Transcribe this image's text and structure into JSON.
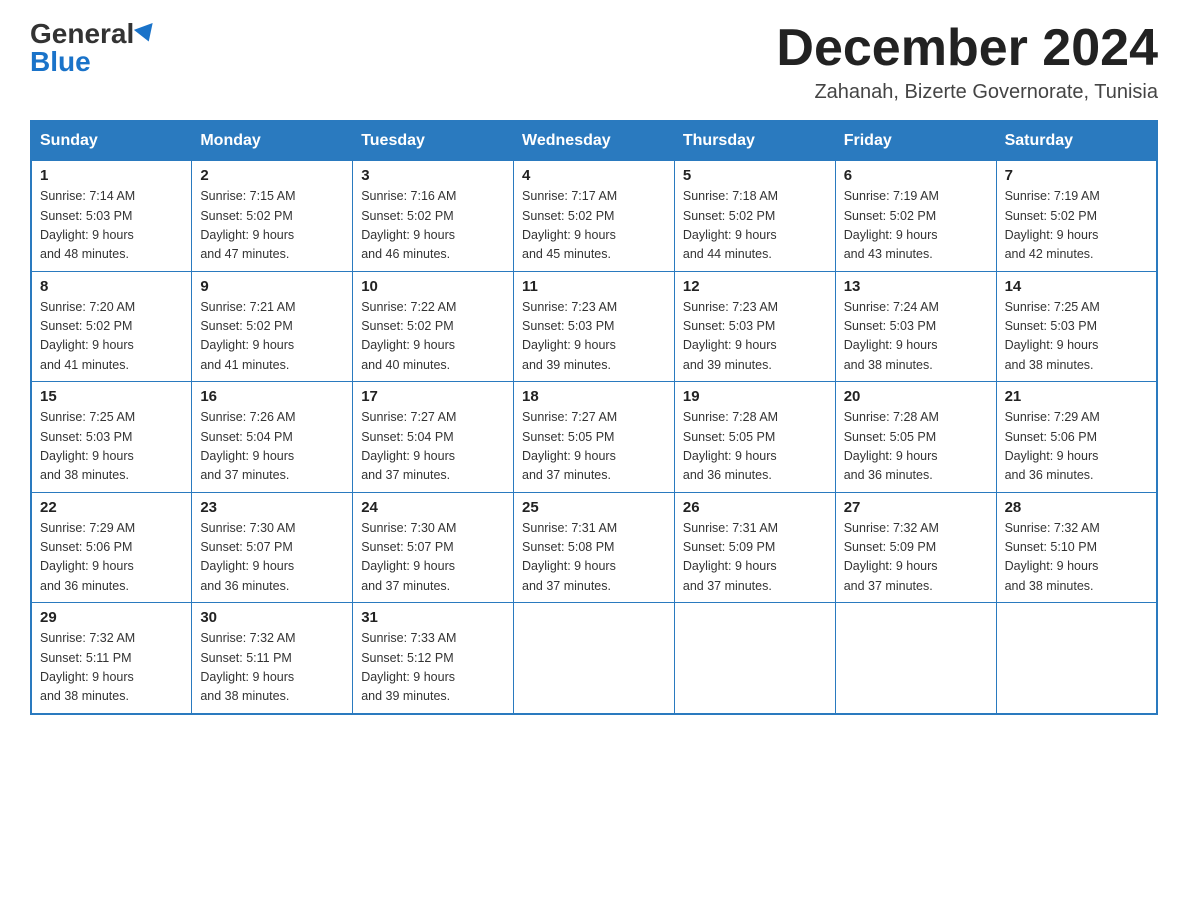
{
  "logo": {
    "general": "General",
    "blue": "Blue"
  },
  "title": "December 2024",
  "subtitle": "Zahanah, Bizerte Governorate, Tunisia",
  "days_of_week": [
    "Sunday",
    "Monday",
    "Tuesday",
    "Wednesday",
    "Thursday",
    "Friday",
    "Saturday"
  ],
  "weeks": [
    [
      {
        "day": "1",
        "sunrise": "7:14 AM",
        "sunset": "5:03 PM",
        "daylight": "9 hours and 48 minutes."
      },
      {
        "day": "2",
        "sunrise": "7:15 AM",
        "sunset": "5:02 PM",
        "daylight": "9 hours and 47 minutes."
      },
      {
        "day": "3",
        "sunrise": "7:16 AM",
        "sunset": "5:02 PM",
        "daylight": "9 hours and 46 minutes."
      },
      {
        "day": "4",
        "sunrise": "7:17 AM",
        "sunset": "5:02 PM",
        "daylight": "9 hours and 45 minutes."
      },
      {
        "day": "5",
        "sunrise": "7:18 AM",
        "sunset": "5:02 PM",
        "daylight": "9 hours and 44 minutes."
      },
      {
        "day": "6",
        "sunrise": "7:19 AM",
        "sunset": "5:02 PM",
        "daylight": "9 hours and 43 minutes."
      },
      {
        "day": "7",
        "sunrise": "7:19 AM",
        "sunset": "5:02 PM",
        "daylight": "9 hours and 42 minutes."
      }
    ],
    [
      {
        "day": "8",
        "sunrise": "7:20 AM",
        "sunset": "5:02 PM",
        "daylight": "9 hours and 41 minutes."
      },
      {
        "day": "9",
        "sunrise": "7:21 AM",
        "sunset": "5:02 PM",
        "daylight": "9 hours and 41 minutes."
      },
      {
        "day": "10",
        "sunrise": "7:22 AM",
        "sunset": "5:02 PM",
        "daylight": "9 hours and 40 minutes."
      },
      {
        "day": "11",
        "sunrise": "7:23 AM",
        "sunset": "5:03 PM",
        "daylight": "9 hours and 39 minutes."
      },
      {
        "day": "12",
        "sunrise": "7:23 AM",
        "sunset": "5:03 PM",
        "daylight": "9 hours and 39 minutes."
      },
      {
        "day": "13",
        "sunrise": "7:24 AM",
        "sunset": "5:03 PM",
        "daylight": "9 hours and 38 minutes."
      },
      {
        "day": "14",
        "sunrise": "7:25 AM",
        "sunset": "5:03 PM",
        "daylight": "9 hours and 38 minutes."
      }
    ],
    [
      {
        "day": "15",
        "sunrise": "7:25 AM",
        "sunset": "5:03 PM",
        "daylight": "9 hours and 38 minutes."
      },
      {
        "day": "16",
        "sunrise": "7:26 AM",
        "sunset": "5:04 PM",
        "daylight": "9 hours and 37 minutes."
      },
      {
        "day": "17",
        "sunrise": "7:27 AM",
        "sunset": "5:04 PM",
        "daylight": "9 hours and 37 minutes."
      },
      {
        "day": "18",
        "sunrise": "7:27 AM",
        "sunset": "5:05 PM",
        "daylight": "9 hours and 37 minutes."
      },
      {
        "day": "19",
        "sunrise": "7:28 AM",
        "sunset": "5:05 PM",
        "daylight": "9 hours and 36 minutes."
      },
      {
        "day": "20",
        "sunrise": "7:28 AM",
        "sunset": "5:05 PM",
        "daylight": "9 hours and 36 minutes."
      },
      {
        "day": "21",
        "sunrise": "7:29 AM",
        "sunset": "5:06 PM",
        "daylight": "9 hours and 36 minutes."
      }
    ],
    [
      {
        "day": "22",
        "sunrise": "7:29 AM",
        "sunset": "5:06 PM",
        "daylight": "9 hours and 36 minutes."
      },
      {
        "day": "23",
        "sunrise": "7:30 AM",
        "sunset": "5:07 PM",
        "daylight": "9 hours and 36 minutes."
      },
      {
        "day": "24",
        "sunrise": "7:30 AM",
        "sunset": "5:07 PM",
        "daylight": "9 hours and 37 minutes."
      },
      {
        "day": "25",
        "sunrise": "7:31 AM",
        "sunset": "5:08 PM",
        "daylight": "9 hours and 37 minutes."
      },
      {
        "day": "26",
        "sunrise": "7:31 AM",
        "sunset": "5:09 PM",
        "daylight": "9 hours and 37 minutes."
      },
      {
        "day": "27",
        "sunrise": "7:32 AM",
        "sunset": "5:09 PM",
        "daylight": "9 hours and 37 minutes."
      },
      {
        "day": "28",
        "sunrise": "7:32 AM",
        "sunset": "5:10 PM",
        "daylight": "9 hours and 38 minutes."
      }
    ],
    [
      {
        "day": "29",
        "sunrise": "7:32 AM",
        "sunset": "5:11 PM",
        "daylight": "9 hours and 38 minutes."
      },
      {
        "day": "30",
        "sunrise": "7:32 AM",
        "sunset": "5:11 PM",
        "daylight": "9 hours and 38 minutes."
      },
      {
        "day": "31",
        "sunrise": "7:33 AM",
        "sunset": "5:12 PM",
        "daylight": "9 hours and 39 minutes."
      },
      null,
      null,
      null,
      null
    ]
  ]
}
